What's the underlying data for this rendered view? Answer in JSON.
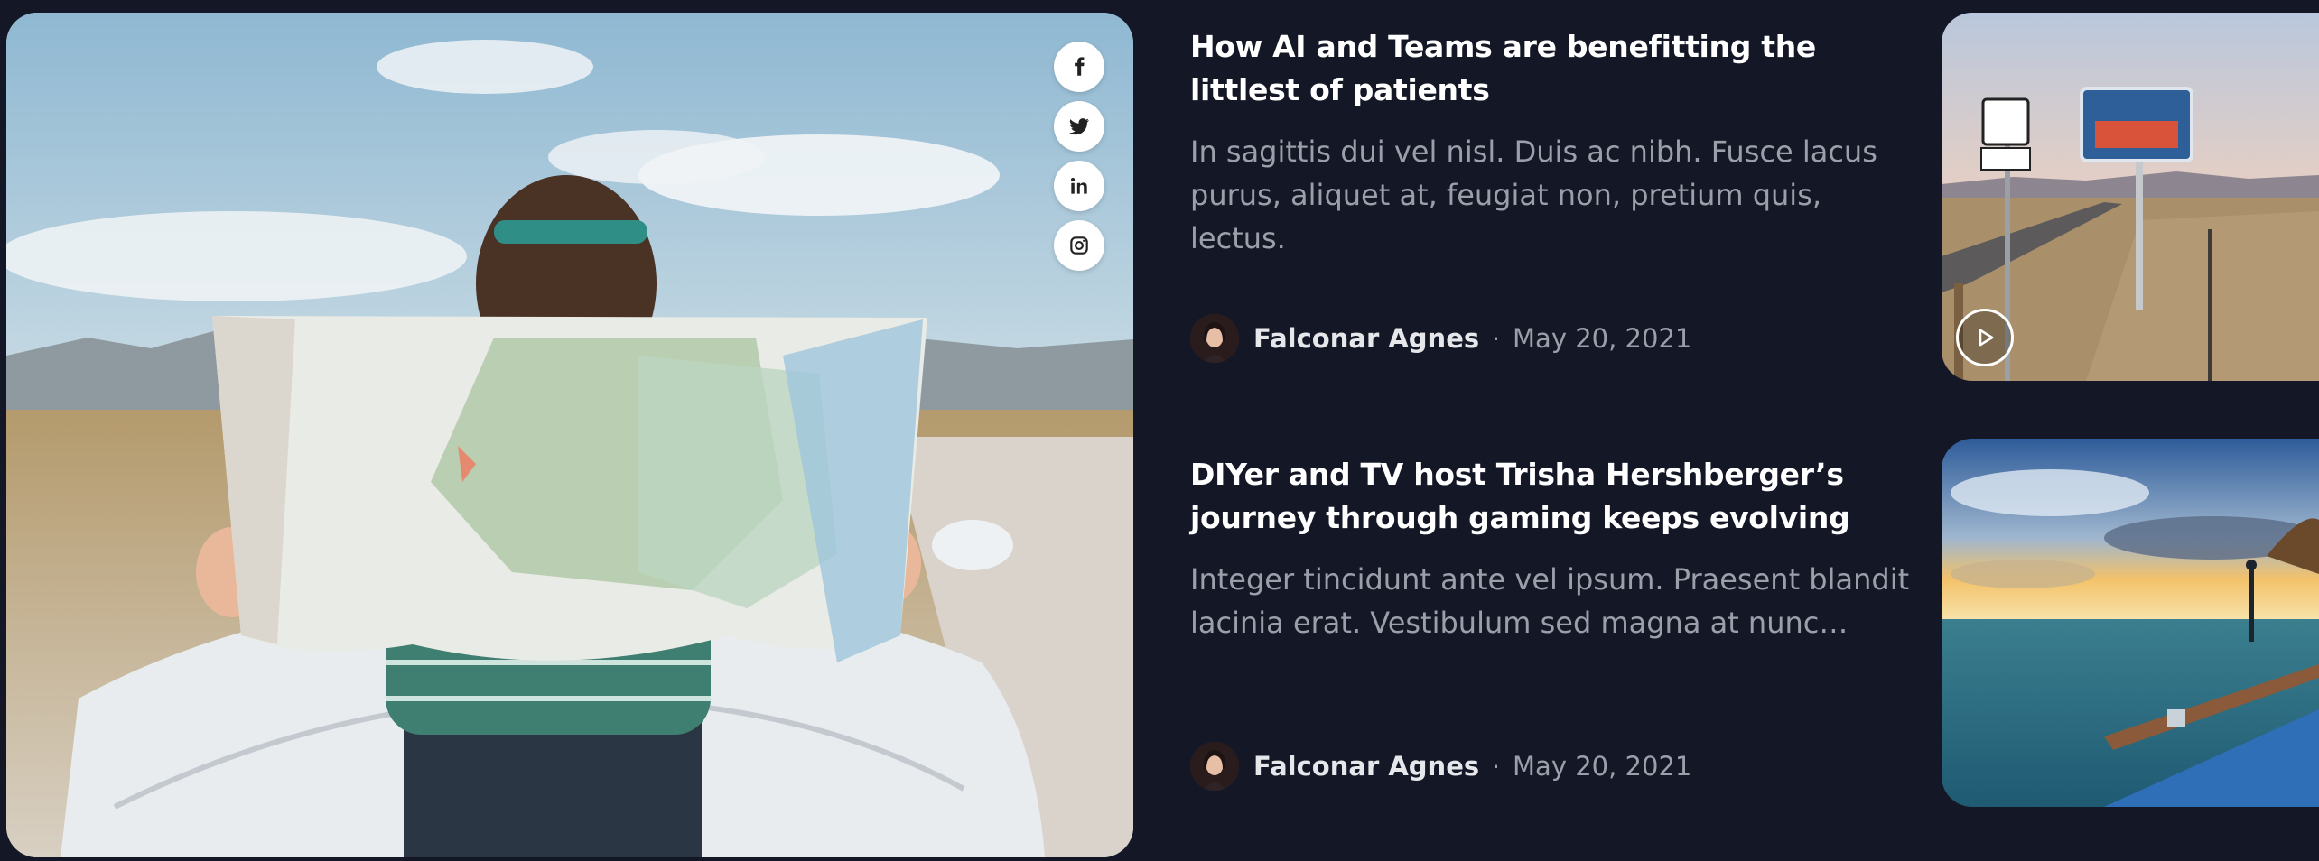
{
  "hero": {
    "social": [
      {
        "name": "facebook",
        "icon": "facebook-icon"
      },
      {
        "name": "twitter",
        "icon": "twitter-icon"
      },
      {
        "name": "linkedin",
        "icon": "linkedin-icon"
      },
      {
        "name": "instagram",
        "icon": "instagram-icon"
      }
    ]
  },
  "articles": [
    {
      "title": "How AI and Teams are benefitting the littlest of patients",
      "excerpt": "In sagittis dui vel nisl. Duis ac nibh. Fusce lacus purus, aliquet at, feugiat non, pretium quis, lectus.",
      "author": "Falconar Agnes",
      "separator": "·",
      "date": "May 20, 2021",
      "thumbnail": {
        "has_video": true,
        "icon": "play-icon"
      }
    },
    {
      "title": "DIYer and TV host Trisha Hershberger’s journey through gaming keeps evolving",
      "excerpt": "Integer tincidunt ante vel ipsum. Praesent blandit lacinia erat. Vestibulum sed magna at nunc…",
      "author": "Falconar Agnes",
      "separator": "·",
      "date": "May 20, 2021",
      "thumbnail": {
        "has_video": false
      }
    }
  ],
  "colors": {
    "background": "#141826",
    "title": "#ffffff",
    "excerpt": "#9b9faa",
    "author": "#e6e7ea"
  }
}
